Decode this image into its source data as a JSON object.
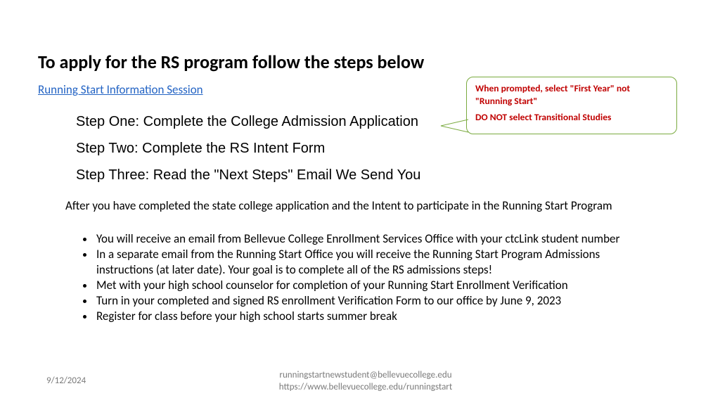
{
  "title": "To apply for the RS program follow the steps below",
  "link": "Running Start Information Session",
  "steps": [
    "Step One: Complete the College Admission Application",
    "Step Two: Complete the RS Intent Form",
    "Step Three: Read the \"Next Steps\" Email We Send You"
  ],
  "intro": "After you have completed the state college application and the Intent to participate in the Running Start Program",
  "bullets": [
    "You will receive an email from Bellevue College Enrollment Services Office with your ctcLink student number",
    "In a separate email from the Running Start Office you will receive the Running Start Program Admissions instructions (at later date). Your goal is to complete all of the RS admissions steps!",
    "Met with your high school counselor for completion of your Running Start Enrollment Verification",
    "Turn in your completed  and signed RS enrollment Verification Form to our office by June 9, 2023",
    "Register for class before your high school starts summer break"
  ],
  "callout": {
    "line1": "When prompted, select \"First Year\" not \"Running Start\"",
    "line2": "DO NOT select Transitional Studies"
  },
  "date": "9/12/2024",
  "footer": {
    "email": "runningstartnewstudent@bellevuecollege.edu",
    "url": "https://www.bellevuecollege.edu/runningstart"
  }
}
